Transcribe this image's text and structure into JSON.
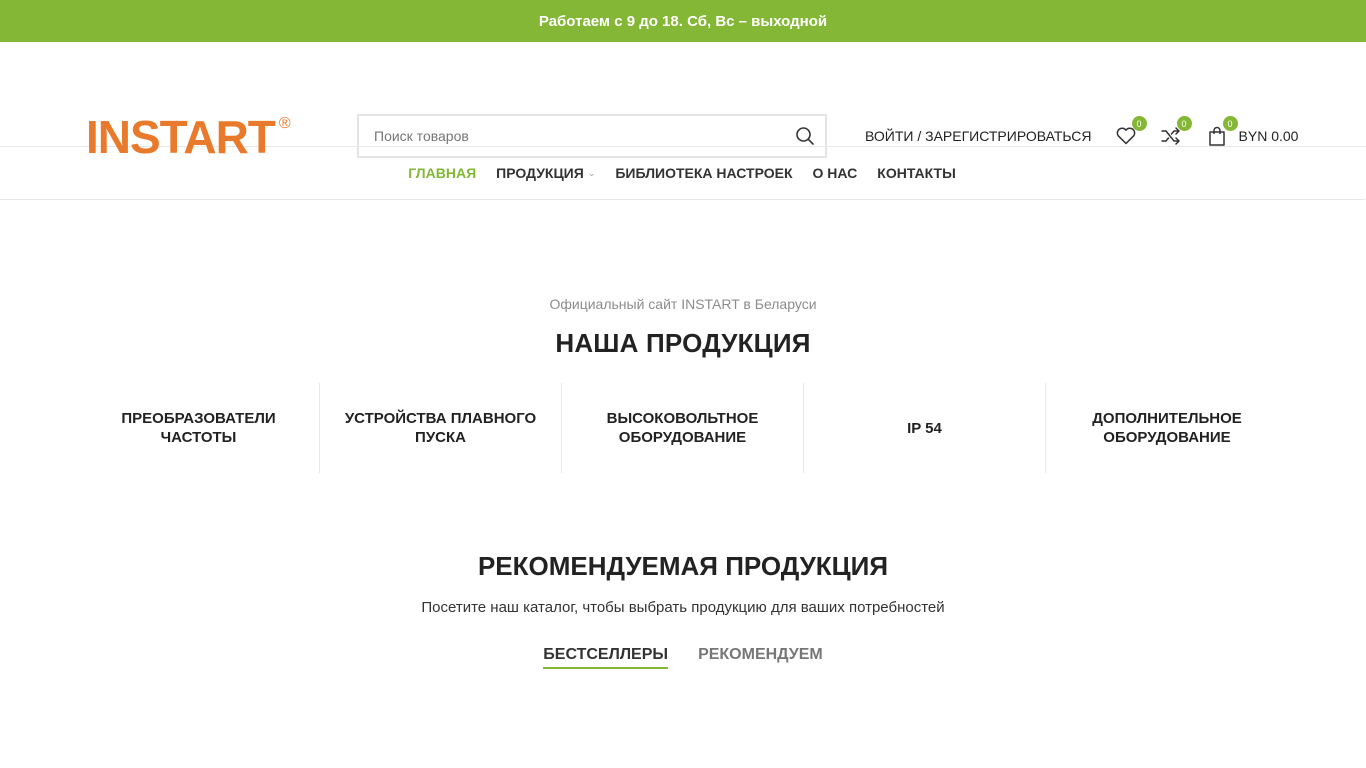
{
  "topbar": {
    "text": "Работаем с 9 до 18. Сб, Вс – выходной"
  },
  "header": {
    "logo_text": "INSTART",
    "logo_mark": "®",
    "search": {
      "placeholder": "Поиск товаров",
      "value": ""
    },
    "login_label": "ВОЙТИ / ЗАРЕГИСТРИРОВАТЬСЯ",
    "wishlist_count": "0",
    "compare_count": "0",
    "cart_count": "0",
    "cart_amount": "BYN 0.00"
  },
  "nav": {
    "items": [
      {
        "label": "ГЛАВНАЯ"
      },
      {
        "label": "ПРОДУКЦИЯ"
      },
      {
        "label": "БИБЛИОТЕКА НАСТРОЕК"
      },
      {
        "label": "О НАС"
      },
      {
        "label": "КОНТАКТЫ"
      }
    ]
  },
  "products": {
    "subtitle": "Официальный сайт INSTART в Беларуси",
    "title": "НАША ПРОДУКЦИЯ",
    "categories": [
      {
        "label": "ПРЕОБРАЗОВАТЕЛИ ЧАСТОТЫ"
      },
      {
        "label": "УСТРОЙСТВА ПЛАВНОГО ПУСКА"
      },
      {
        "label": "ВЫСОКОВОЛЬТНОЕ ОБОРУДОВАНИЕ"
      },
      {
        "label": "IP 54"
      },
      {
        "label": "ДОПОЛНИТЕЛЬНОЕ ОБОРУДОВАНИЕ"
      }
    ]
  },
  "featured": {
    "title": "РЕКОМЕНДУЕМАЯ ПРОДУКЦИЯ",
    "subtitle": "Посетите наш каталог, чтобы выбрать продукцию для ваших потребностей",
    "tabs": [
      {
        "label": "БЕСТСЕЛЛЕРЫ"
      },
      {
        "label": "РЕКОМЕНДУЕМ"
      }
    ]
  },
  "colors": {
    "accent": "#83b735",
    "logo": "#e97a2b"
  }
}
